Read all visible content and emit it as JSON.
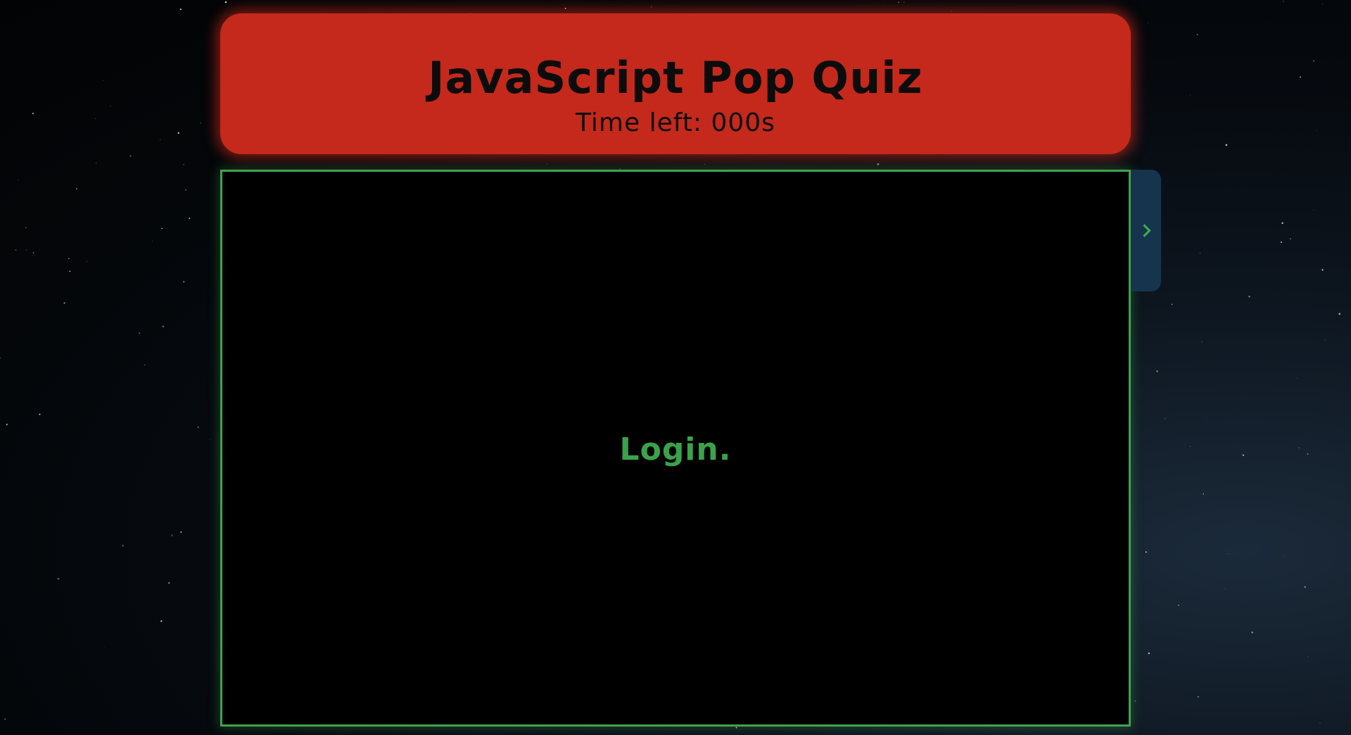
{
  "header": {
    "title": "JavaScript Pop Quiz",
    "timer": "Time left: 000s"
  },
  "quiz": {
    "login_label": "Login."
  },
  "drawer": {
    "toggle_icon": "chevron-right-icon"
  },
  "colors": {
    "header_bg": "#c4291c",
    "header_text": "#0c0c0c",
    "panel_border": "#3fa34d",
    "panel_text": "#3aa34a",
    "drawer_bg": "#17344f",
    "page_bg": "#05080c"
  }
}
